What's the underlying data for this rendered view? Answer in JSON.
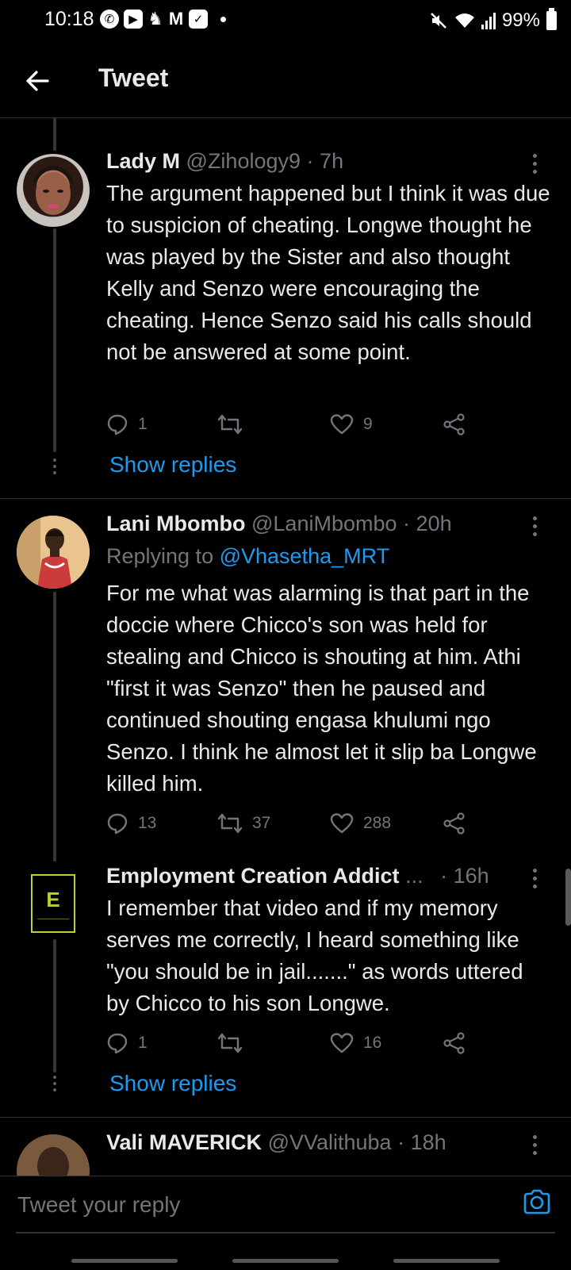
{
  "status_bar": {
    "time": "10:18",
    "battery": "99%",
    "left_icons": [
      "whatsapp-icon",
      "youtube-icon",
      "app-icon",
      "gmail-icon",
      "checkbox-icon"
    ],
    "right_icons": [
      "mute-icon",
      "wifi-icon",
      "signal-icon",
      "battery-icon"
    ]
  },
  "header": {
    "title": "Tweet"
  },
  "tweets": [
    {
      "display_name": "Lady M",
      "handle": "@Zihology9",
      "separator": "·",
      "time": "7h",
      "text": "The argument happened but I think it was due to suspicion of cheating. Longwe thought he was played by the Sister and also thought Kelly and Senzo were encouraging the cheating. Hence Senzo said his calls should not be answered at some point.",
      "replies": "1",
      "retweets": "",
      "likes": "9",
      "show_replies": "Show replies"
    },
    {
      "display_name": "Lani Mbombo",
      "handle": "@LaniMbombo",
      "separator": "·",
      "time": "20h",
      "replying_prefix": "Replying to",
      "replying_handle": "@Vhasetha_MRT",
      "text": "For me what was alarming is that part in the doccie where Chicco's son was held for stealing and Chicco is shouting at him. Athi \"first it was Senzo\" then he paused and continued shouting engasa khulumi ngo Senzo. I think he almost let it slip ba Longwe killed him.",
      "replies": "13",
      "retweets": "37",
      "likes": "288"
    },
    {
      "display_name": "Employment Creation Addict",
      "ellipsis": "...",
      "separator": "·",
      "time": "16h",
      "avatar_letter": "E",
      "text": "I remember that video and if my memory serves me correctly, I heard something like \"you should be in jail.......\" as words uttered by Chicco  to his son Longwe.",
      "replies": "1",
      "retweets": "",
      "likes": "16",
      "show_replies": "Show replies"
    },
    {
      "display_name": "Vali MAVERICK",
      "handle": "@VValithuba",
      "separator": "·",
      "time": "18h"
    }
  ],
  "reply_bar": {
    "placeholder": "Tweet your reply"
  },
  "colors": {
    "background": "#000000",
    "text": "#e7e9ea",
    "muted": "#71767b",
    "link": "#1d9bf0",
    "divider": "#2f3336"
  }
}
